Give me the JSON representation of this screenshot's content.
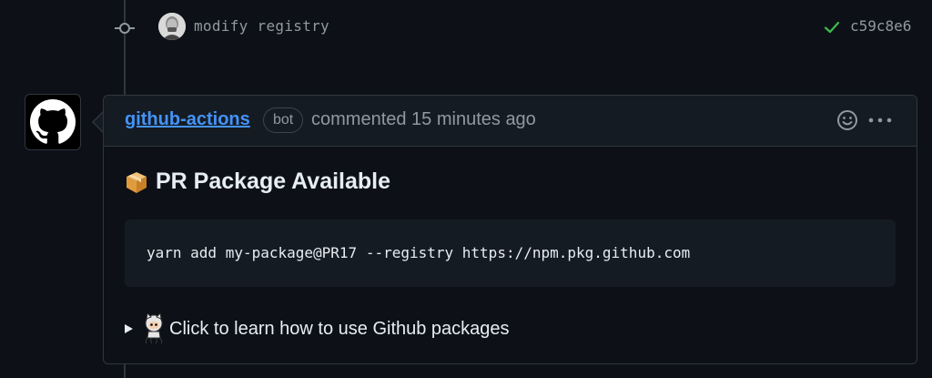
{
  "commit": {
    "message": "modify registry",
    "sha": "c59c8e6",
    "check_color": "#3fb950"
  },
  "comment": {
    "author": "github-actions",
    "badge": "bot",
    "meta": "commented 15 minutes ago",
    "heading": "PR Package Available",
    "heading_icon": "package-icon",
    "code": "yarn add my-package@PR17 --registry https://npm.pkg.github.com",
    "details_summary": "Click to learn how to use Github packages",
    "details_icon": "octocat-icon"
  },
  "colors": {
    "background": "#0d1117",
    "header_bg": "#151b23",
    "border": "#30363d",
    "link": "#4493f8",
    "muted": "#9198a1",
    "text": "#e6edf3"
  }
}
